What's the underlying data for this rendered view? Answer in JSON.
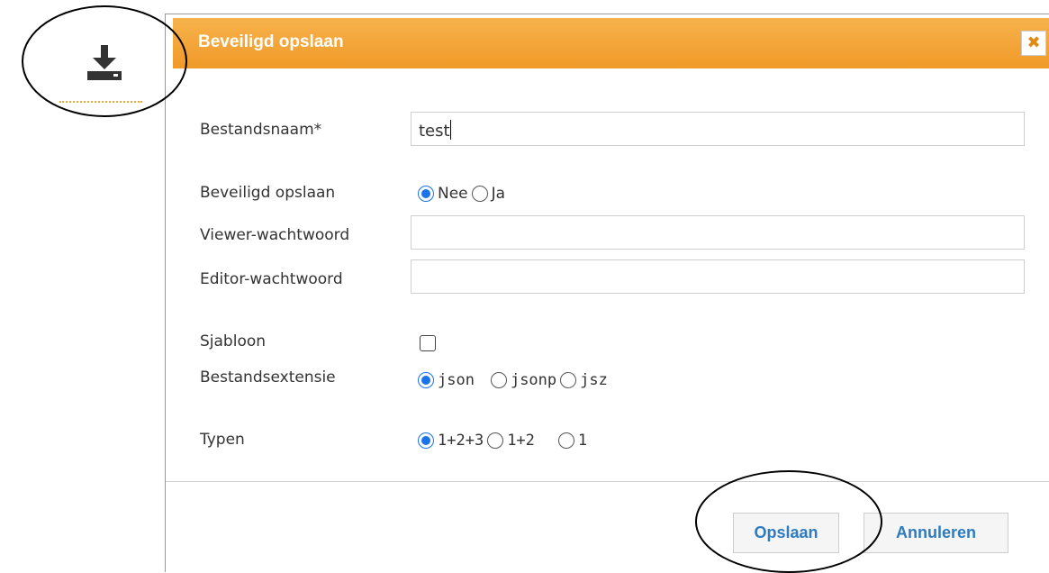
{
  "toolbar": {
    "download_icon": "download-icon"
  },
  "dialog": {
    "title": "Beveiligd opslaan",
    "close_icon": "close-icon",
    "filename": {
      "label": "Bestandsnaam*",
      "value": "test"
    },
    "secure": {
      "label": "Beveiligd opslaan",
      "options": [
        "Nee",
        "Ja"
      ],
      "selected": "Nee"
    },
    "viewer_password": {
      "label": "Viewer-wachtwoord",
      "value": ""
    },
    "editor_password": {
      "label": "Editor-wachtwoord",
      "value": ""
    },
    "template": {
      "label": "Sjabloon",
      "checked": false
    },
    "extension": {
      "label": "Bestandsextensie",
      "options": [
        "json",
        "jsonp",
        "jsz"
      ],
      "selected": "json"
    },
    "types": {
      "label": "Typen",
      "options": [
        "1+2+3",
        "1+2",
        "1"
      ],
      "selected": "1+2+3"
    },
    "save_label": "Opslaan",
    "cancel_label": "Annuleren"
  },
  "colors": {
    "title_bar": "#f2a33a",
    "accent": "#1a73e8",
    "button_text": "#2e7bbf"
  }
}
